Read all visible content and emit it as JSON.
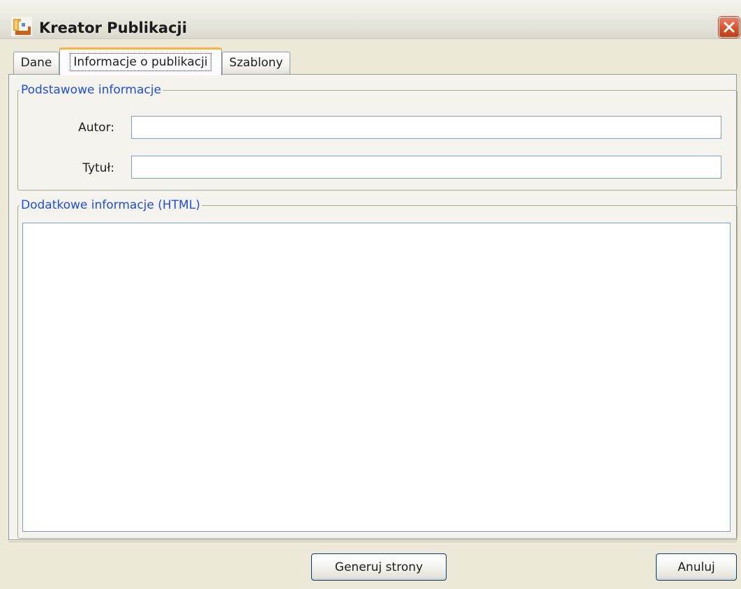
{
  "window": {
    "title": "Kreator Publikacji",
    "app_icon": "app-logo-icon",
    "close_icon": "close-icon"
  },
  "tabs": [
    {
      "label": "Dane",
      "selected": false
    },
    {
      "label": "Informacje o publikacji",
      "selected": true
    },
    {
      "label": "Szablony",
      "selected": false
    }
  ],
  "basic_info": {
    "legend": "Podstawowe informacje",
    "author_label": "Autor:",
    "author_value": "",
    "title_label": "Tytuł:",
    "title_value": ""
  },
  "extra_info": {
    "legend": "Dodatkowe informacje (HTML)",
    "value": ""
  },
  "buttons": {
    "generate": "Generuj strony",
    "cancel": "Anuluj"
  },
  "colors": {
    "legend_text": "#1f4ed8",
    "selected_tab_accent": "#ffb33c",
    "close_button": "#d6542f"
  }
}
